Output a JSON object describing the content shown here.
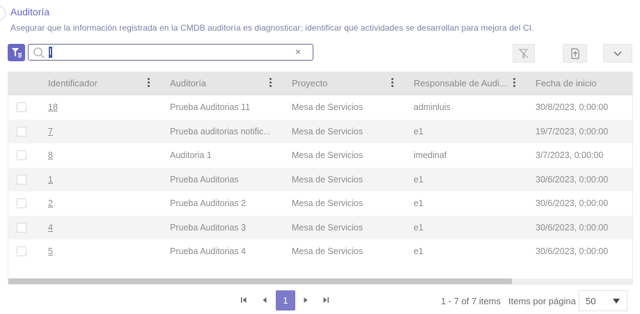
{
  "header": {
    "title": "Auditoría",
    "subtitle": "Asegurar que la información registrada en la CMDB auditoría es diagnosticar; identificar qué actividades se desarrollan para mejora del CI."
  },
  "search": {
    "value": "l",
    "clear_glyph": "×"
  },
  "icons": {
    "filter": "filter-list-icon",
    "search": "search-icon",
    "clear_filter": "clear-filter-icon",
    "export": "export-icon",
    "more": "chevron-down-icon"
  },
  "colors": {
    "accent": "#6b67c7",
    "title": "#6b63c6",
    "header_bg": "#e6e6e6",
    "row_alt": "#f4f4f4",
    "selection": "#2f58c9"
  },
  "table": {
    "columns": [
      "Identificador",
      "Auditoría",
      "Proyecto",
      "Responsable de Audi...",
      "Fecha de inicio"
    ],
    "rows": [
      {
        "id": "18",
        "auditoria": "Prueba Auditorias 11",
        "proyecto": "Mesa de Servicios",
        "responsable": "adminluis",
        "fecha": "30/8/2023, 0:00:00"
      },
      {
        "id": "7",
        "auditoria": "Prueba auditorias notific...",
        "proyecto": "Mesa de Servicios",
        "responsable": "e1",
        "fecha": "19/7/2023, 0:00:00"
      },
      {
        "id": "8",
        "auditoria": "Auditoria 1",
        "proyecto": "Mesa de Servicios",
        "responsable": "imedinaf",
        "fecha": "3/7/2023, 0:00:00"
      },
      {
        "id": "1",
        "auditoria": "Prueba Auditorias",
        "proyecto": "Mesa de Servicios",
        "responsable": "e1",
        "fecha": "30/6/2023, 0:00:00"
      },
      {
        "id": "2",
        "auditoria": "Prueba Auditorias 2",
        "proyecto": "Mesa de Servicios",
        "responsable": "e1",
        "fecha": "30/6/2023, 0:00:00"
      },
      {
        "id": "4",
        "auditoria": "Prueba Auditorias 3",
        "proyecto": "Mesa de Servicios",
        "responsable": "e1",
        "fecha": "30/6/2023, 0:00:00"
      },
      {
        "id": "5",
        "auditoria": "Prueba Auditorias 4",
        "proyecto": "Mesa de Servicios",
        "responsable": "e1",
        "fecha": "30/6/2023, 0:00:00"
      }
    ]
  },
  "pager": {
    "current_page": "1",
    "items_info": "1 - 7 of 7 items",
    "items_label": "Items por página",
    "page_size": "50"
  }
}
